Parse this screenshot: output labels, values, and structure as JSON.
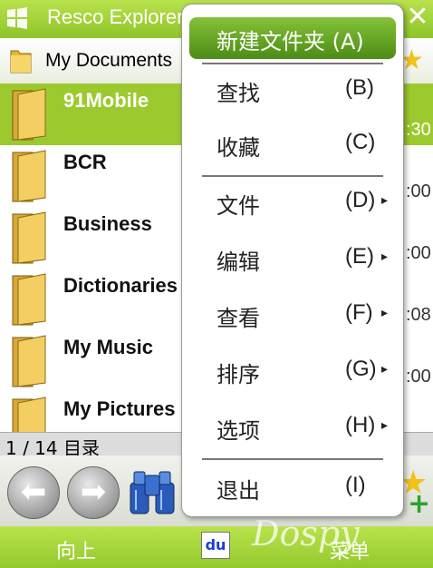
{
  "titlebar": {
    "title": "Resco Explorer",
    "close_glyph": "✕"
  },
  "pathbar": {
    "path": "My Documents"
  },
  "files": [
    {
      "name": "91Mobile",
      "time": ":30",
      "selected": true
    },
    {
      "name": "BCR",
      "time": ":00"
    },
    {
      "name": "Business",
      "time": ":00"
    },
    {
      "name": "Dictionaries",
      "time": ":08"
    },
    {
      "name": "My Music",
      "time": ":00"
    },
    {
      "name": "My Pictures",
      "time": ""
    }
  ],
  "status": {
    "text": "1 / 14 目录"
  },
  "toolbar": {
    "back_glyph": "⬅",
    "forward_glyph": "➡"
  },
  "softkeys": {
    "left": "向上",
    "right": "菜单",
    "du_label": "du"
  },
  "watermark": "Dospy",
  "menu": {
    "top_item": {
      "label": "新建文件夹 (A)"
    },
    "items": [
      {
        "label": "查找",
        "accel": "(B)",
        "submenu": false
      },
      {
        "label": "收藏",
        "accel": "(C)",
        "submenu": false
      },
      {
        "label": "文件",
        "accel": "(D)",
        "submenu": true
      },
      {
        "label": "编辑",
        "accel": "(E)",
        "submenu": true
      },
      {
        "label": "查看",
        "accel": "(F)",
        "submenu": true
      },
      {
        "label": "排序",
        "accel": "(G)",
        "submenu": true
      },
      {
        "label": "选项",
        "accel": "(H)",
        "submenu": true
      },
      {
        "label": "退出",
        "accel": "(I)",
        "submenu": false
      }
    ],
    "arrow_glyph": "▸"
  },
  "colors": {
    "accent_green": "#9cca2e",
    "folder_yellow": "#f0c842"
  }
}
